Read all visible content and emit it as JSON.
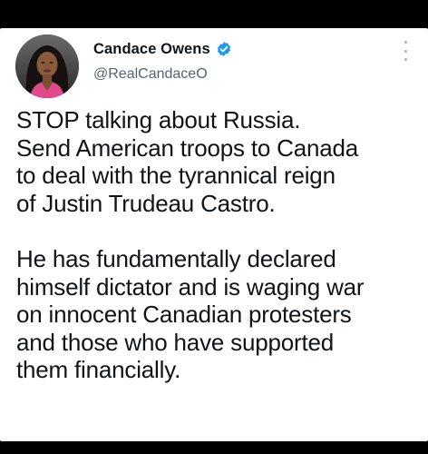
{
  "tweet": {
    "author": {
      "display_name": "Candace Owens",
      "handle": "@RealCandaceO",
      "verified": true,
      "verified_badge_color": "#1d9bf0"
    },
    "menu_icon": "more-vertical-icon",
    "paragraphs": [
      {
        "lines": [
          "STOP talking about Russia.",
          "Send American troops to Canada",
          "to deal with the tyrannical reign",
          "of Justin Trudeau Castro."
        ]
      },
      {
        "lines": [
          "He has fundamentally declared",
          "himself dictator and is waging war",
          "on innocent Canadian protesters",
          "and those who have supported",
          "them financially."
        ]
      }
    ]
  },
  "colors": {
    "background": "#000000",
    "card": "#ffffff",
    "text": "#0f1419",
    "secondary_text": "#536471"
  }
}
